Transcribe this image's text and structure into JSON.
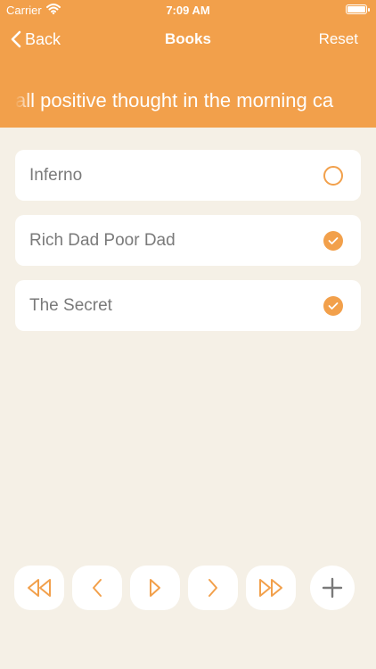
{
  "status_bar": {
    "carrier": "Carrier",
    "time": "7:09 AM"
  },
  "nav": {
    "back_label": "Back",
    "title": "Books",
    "reset_label": "Reset"
  },
  "marquee": {
    "text": "all positive thought in the morning ca"
  },
  "books": [
    {
      "label": "Inferno",
      "checked": false
    },
    {
      "label": "Rich Dad Poor Dad",
      "checked": true
    },
    {
      "label": "The Secret",
      "checked": true
    }
  ],
  "toolbar": {
    "buttons": [
      "rewind-icon",
      "chevron-left-icon",
      "play-icon",
      "chevron-right-icon",
      "fast-forward-icon"
    ],
    "add": "plus-icon"
  },
  "colors": {
    "accent": "#F2A04B",
    "background": "#F5F0E6",
    "card": "#FFFFFF",
    "text_muted": "#7A7A7A"
  }
}
